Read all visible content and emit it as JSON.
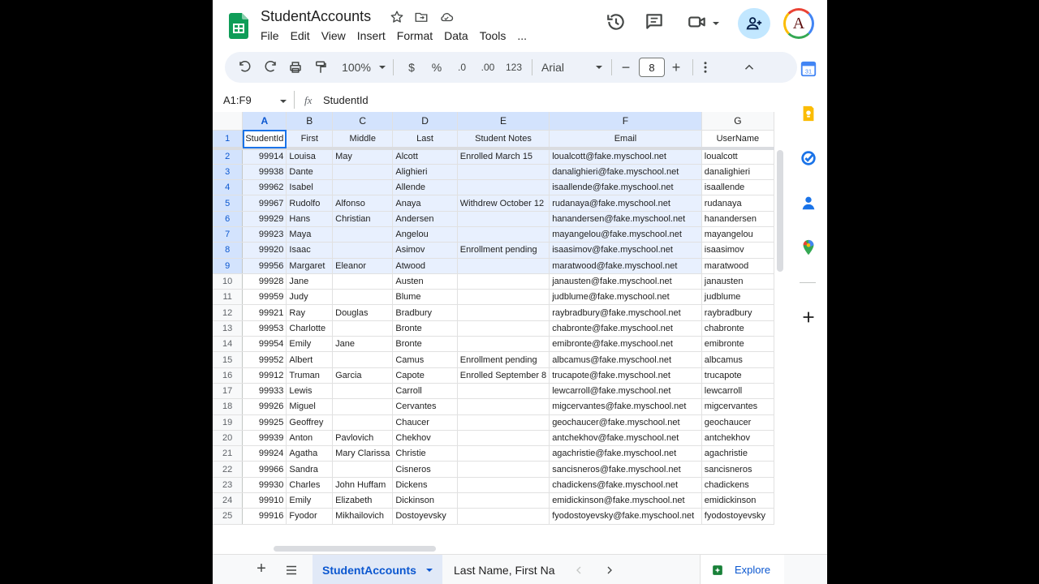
{
  "doc": {
    "title": "StudentAccounts"
  },
  "menu": [
    "File",
    "Edit",
    "View",
    "Insert",
    "Format",
    "Data",
    "Tools",
    "..."
  ],
  "toolbar": {
    "zoom": "100%",
    "currency": "$",
    "percent": "%",
    "decrease_decimals": ".0",
    "increase_decimals": ".00",
    "more_formats": "123",
    "font": "Arial",
    "font_size": "8",
    "minus": "−",
    "plus": "+"
  },
  "formula_bar": {
    "name_box": "A1:F9",
    "fx": "fx",
    "content": "StudentId"
  },
  "columns": [
    "A",
    "B",
    "C",
    "D",
    "E",
    "F",
    "G"
  ],
  "headers": [
    "StudentId",
    "First",
    "Middle",
    "Last",
    "Student Notes",
    "Email",
    "UserName"
  ],
  "rows": [
    [
      "99914",
      "Louisa",
      "May",
      "Alcott",
      "Enrolled March 15",
      "loualcott@fake.myschool.net",
      "loualcott"
    ],
    [
      "99938",
      "Dante",
      "",
      "Alighieri",
      "",
      "danalighieri@fake.myschool.net",
      "danalighieri"
    ],
    [
      "99962",
      "Isabel",
      "",
      "Allende",
      "",
      "isaallende@fake.myschool.net",
      "isaallende"
    ],
    [
      "99967",
      "Rudolfo",
      "Alfonso",
      "Anaya",
      "Withdrew October 12",
      "rudanaya@fake.myschool.net",
      "rudanaya"
    ],
    [
      "99929",
      "Hans",
      "Christian",
      "Andersen",
      "",
      "hanandersen@fake.myschool.net",
      "hanandersen"
    ],
    [
      "99923",
      "Maya",
      "",
      "Angelou",
      "",
      "mayangelou@fake.myschool.net",
      "mayangelou"
    ],
    [
      "99920",
      "Isaac",
      "",
      "Asimov",
      "Enrollment pending",
      "isaasimov@fake.myschool.net",
      "isaasimov"
    ],
    [
      "99956",
      "Margaret",
      "Eleanor",
      "Atwood",
      "",
      "maratwood@fake.myschool.net",
      "maratwood"
    ],
    [
      "99928",
      "Jane",
      "",
      "Austen",
      "",
      "janausten@fake.myschool.net",
      "janausten"
    ],
    [
      "99959",
      "Judy",
      "",
      "Blume",
      "",
      "judblume@fake.myschool.net",
      "judblume"
    ],
    [
      "99921",
      "Ray",
      "Douglas",
      "Bradbury",
      "",
      "raybradbury@fake.myschool.net",
      "raybradbury"
    ],
    [
      "99953",
      "Charlotte",
      "",
      "Bronte",
      "",
      "chabronte@fake.myschool.net",
      "chabronte"
    ],
    [
      "99954",
      "Emily",
      "Jane",
      "Bronte",
      "",
      "emibronte@fake.myschool.net",
      "emibronte"
    ],
    [
      "99952",
      "Albert",
      "",
      "Camus",
      "Enrollment pending",
      "albcamus@fake.myschool.net",
      "albcamus"
    ],
    [
      "99912",
      "Truman",
      "Garcia",
      "Capote",
      "Enrolled September 8",
      "trucapote@fake.myschool.net",
      "trucapote"
    ],
    [
      "99933",
      "Lewis",
      "",
      "Carroll",
      "",
      "lewcarroll@fake.myschool.net",
      "lewcarroll"
    ],
    [
      "99926",
      "Miguel",
      "",
      "Cervantes",
      "",
      "migcervantes@fake.myschool.net",
      "migcervantes"
    ],
    [
      "99925",
      "Geoffrey",
      "",
      "Chaucer",
      "",
      "geochaucer@fake.myschool.net",
      "geochaucer"
    ],
    [
      "99939",
      "Anton",
      "Pavlovich",
      "Chekhov",
      "",
      "antchekhov@fake.myschool.net",
      "antchekhov"
    ],
    [
      "99924",
      "Agatha",
      "Mary Clarissa",
      "Christie",
      "",
      "agachristie@fake.myschool.net",
      "agachristie"
    ],
    [
      "99966",
      "Sandra",
      "",
      "Cisneros",
      "",
      "sancisneros@fake.myschool.net",
      "sancisneros"
    ],
    [
      "99930",
      "Charles",
      "John Huffam",
      "Dickens",
      "",
      "chadickens@fake.myschool.net",
      "chadickens"
    ],
    [
      "99910",
      "Emily",
      "Elizabeth",
      "Dickinson",
      "",
      "emidickinson@fake.myschool.net",
      "emidickinson"
    ],
    [
      "99916",
      "Fyodor",
      "Mikhailovich",
      "Dostoyevsky",
      "",
      "fyodostoyevsky@fake.myschool.net",
      "fyodostoyevsky"
    ]
  ],
  "sheets": {
    "add": "+",
    "active": "StudentAccounts",
    "second": "Last Name, First Na",
    "explore": "Explore"
  }
}
